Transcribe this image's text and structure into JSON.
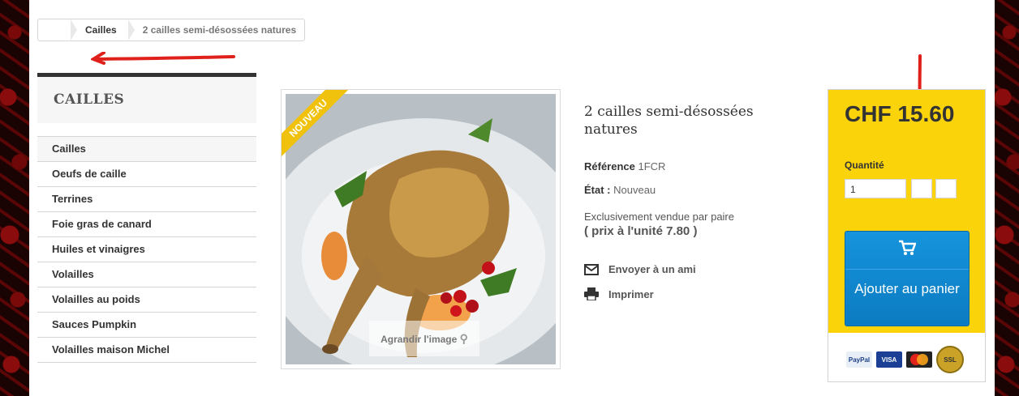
{
  "breadcrumb": {
    "category": "Cailles",
    "current": "2 cailles semi-désossées natures"
  },
  "sidebar": {
    "title": "CAILLES",
    "items": [
      {
        "label": "Cailles"
      },
      {
        "label": "Oeufs de caille"
      },
      {
        "label": "Terrines"
      },
      {
        "label": "Foie gras de canard"
      },
      {
        "label": "Huiles et vinaigres"
      },
      {
        "label": "Volailles"
      },
      {
        "label": "Volailles au poids"
      },
      {
        "label": "Sauces Pumpkin"
      },
      {
        "label": "Volailles maison Michel"
      }
    ]
  },
  "product": {
    "badge": "Nouveau",
    "zoom_label": "Agrandir l'image",
    "title": "2 cailles semi-désossées natures",
    "reference_label": "Référence",
    "reference": "1FCR",
    "condition_label": "État :",
    "condition": "Nouveau",
    "pair_note": "Exclusivement vendue par paire",
    "unit_price": "( prix à l'unité 7.80 )",
    "send_friend": "Envoyer à un ami",
    "print": "Imprimer"
  },
  "buy": {
    "price": "CHF 15.60",
    "quantity_label": "Quantité",
    "quantity": "1",
    "add_to_cart": "Ajouter au panier",
    "payment_logos": [
      "PayPal",
      "VISA",
      "MasterCard",
      "SSL"
    ]
  },
  "colors": {
    "accent_yellow": "#fbd30a",
    "button_blue": "#0c7bc1",
    "annotation_red": "#e0201b"
  }
}
